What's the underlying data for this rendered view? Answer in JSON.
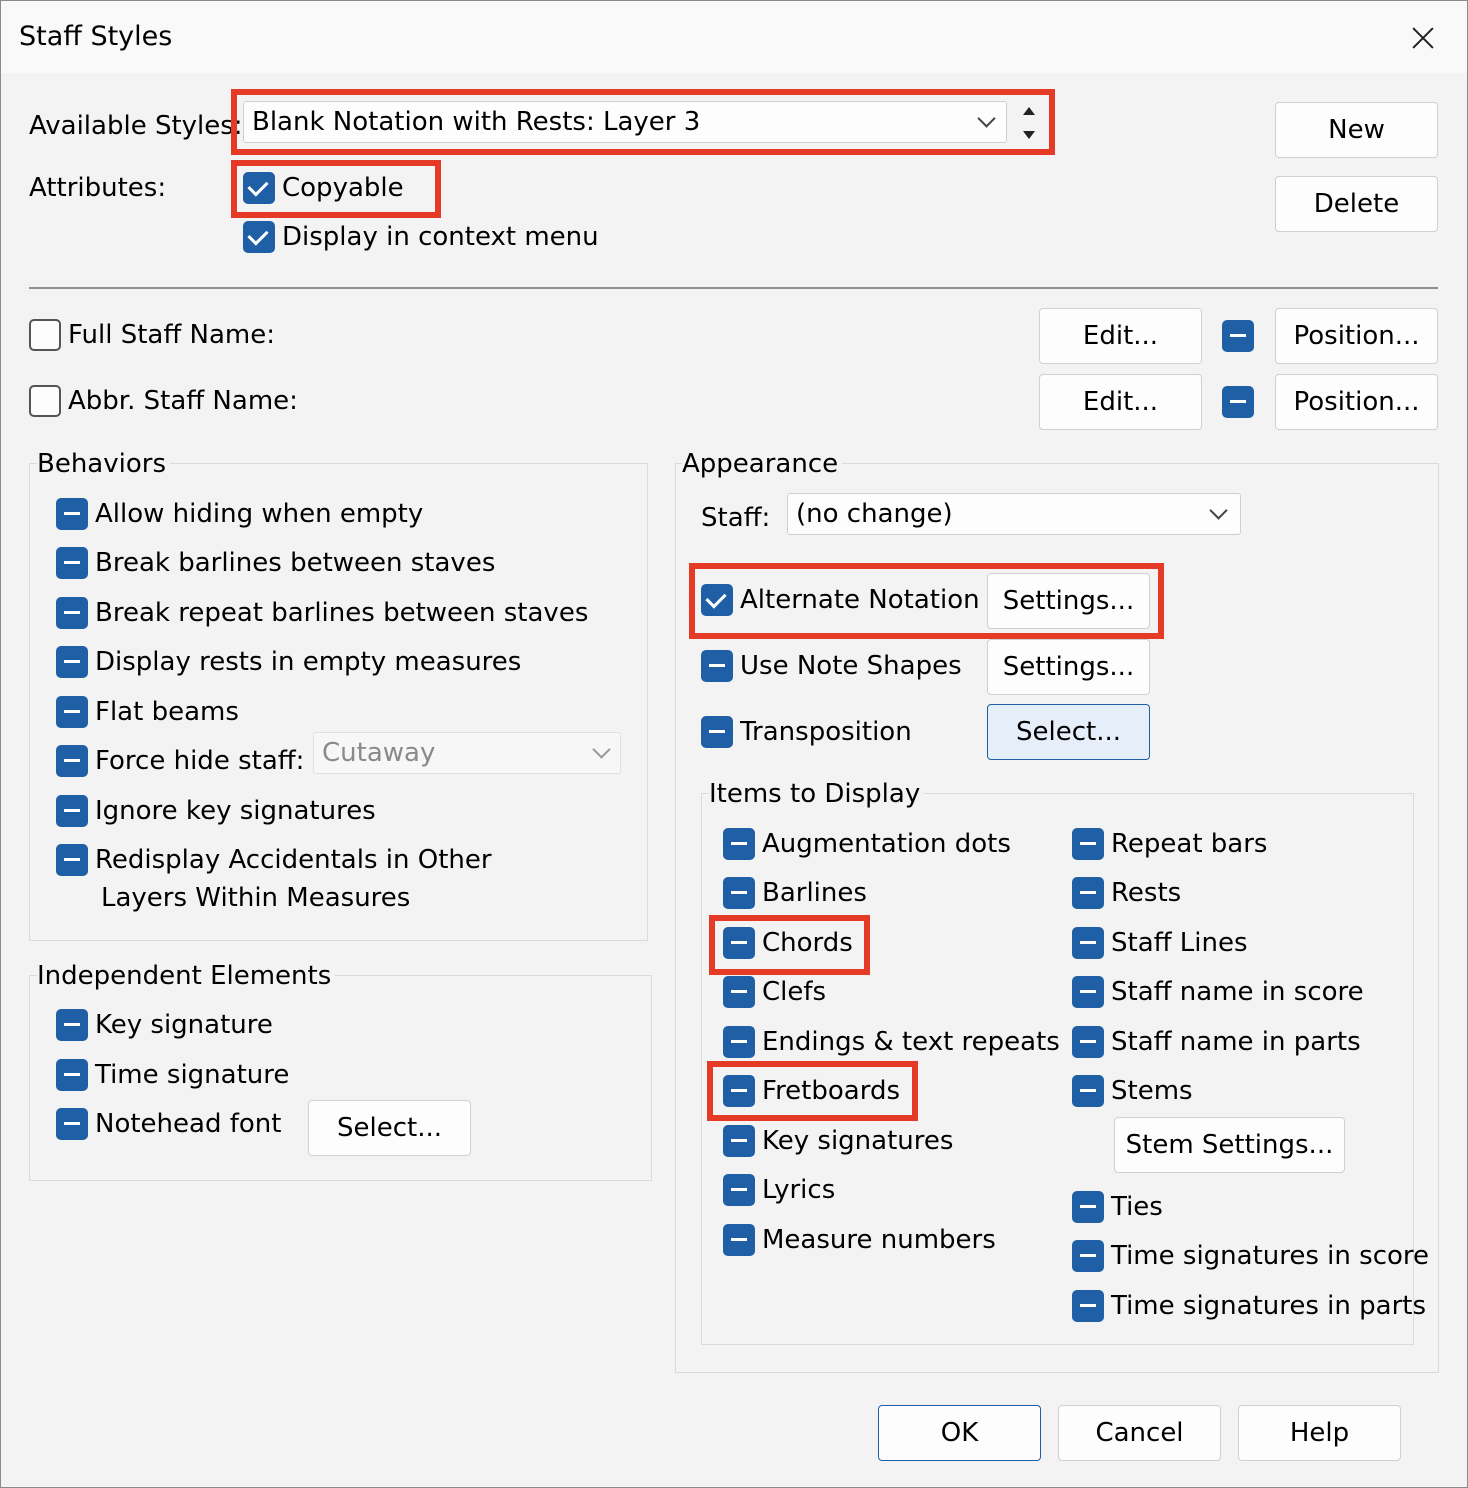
{
  "title": "Staff Styles",
  "available_styles": {
    "label": "Available Styles:",
    "value": "Blank Notation with Rests: Layer 3"
  },
  "attributes": {
    "label": "Attributes:",
    "copyable": "Copyable",
    "display_in_context_menu": "Display in context menu"
  },
  "buttons": {
    "new": "New",
    "delete": "Delete",
    "ok": "OK",
    "cancel": "Cancel",
    "help": "Help"
  },
  "full_staff_name": {
    "label": "Full Staff Name:",
    "edit": "Edit...",
    "position": "Position..."
  },
  "abbr_staff_name": {
    "label": "Abbr. Staff Name:",
    "edit": "Edit...",
    "position": "Position..."
  },
  "behaviors": {
    "title": "Behaviors",
    "items": [
      "Allow hiding when empty",
      "Break barlines between staves",
      "Break repeat barlines between staves",
      "Display rests in empty measures",
      "Flat beams",
      "Force hide staff:",
      "Ignore key signatures",
      "Redisplay Accidentals in Other",
      "Layers Within Measures"
    ],
    "force_hide_value": "Cutaway"
  },
  "independent": {
    "title": "Independent Elements",
    "items": [
      "Key signature",
      "Time signature",
      "Notehead font"
    ],
    "select": "Select..."
  },
  "appearance": {
    "title": "Appearance",
    "staff_label": "Staff:",
    "staff_value": "(no change)",
    "alternate_notation": "Alternate Notation",
    "use_note_shapes": "Use Note Shapes",
    "transposition": "Transposition",
    "settings": "Settings...",
    "select": "Select..."
  },
  "items_to_display": {
    "title": "Items to Display",
    "left": [
      "Augmentation dots",
      "Barlines",
      "Chords",
      "Clefs",
      "Endings & text repeats",
      "Fretboards",
      "Key signatures",
      "Lyrics",
      "Measure numbers"
    ],
    "right": [
      "Repeat bars",
      "Rests",
      "Staff Lines",
      "Staff name in score",
      "Staff name in parts",
      "Stems",
      "Ties",
      "Time signatures in score",
      "Time signatures in parts"
    ],
    "stem_settings": "Stem Settings..."
  },
  "colors": {
    "accent": "#1f5fa6",
    "highlight": "#e53a25"
  }
}
